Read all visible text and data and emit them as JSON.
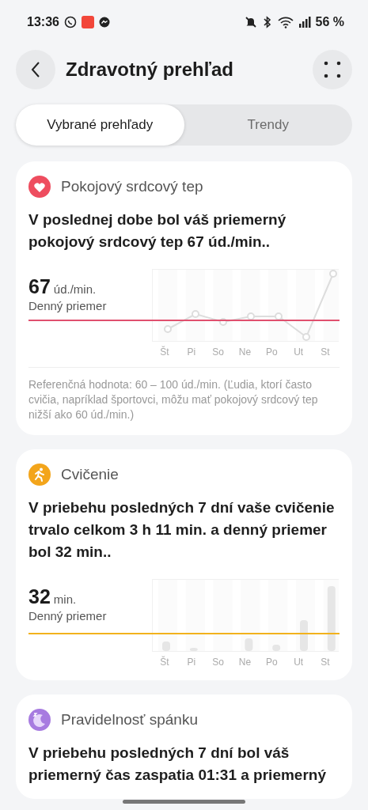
{
  "status_bar": {
    "time": "13:36",
    "battery": "56 %"
  },
  "header": {
    "title": "Zdravotný prehľad"
  },
  "tabs": [
    {
      "label": "Vybrané prehľady",
      "selected": true
    },
    {
      "label": "Trendy",
      "selected": false
    }
  ],
  "cards": [
    {
      "kind": "heart",
      "title": "Pokojový srdcový tep",
      "summary": "V poslednej dobe bol váš priemerný pokojový srdcový tep 67 úd./min..",
      "value": "67",
      "unit": "úd./min.",
      "caption": "Denný priemer",
      "color": "#e0506e",
      "days": [
        "Št",
        "Pi",
        "So",
        "Ne",
        "Po",
        "Ut",
        "St"
      ],
      "note": "Referenčná hodnota: 60 – 100 úd./min. (Ľudia, ktorí často cvičia, napríklad športovci, môžu mať pokojový srdcový tep nižší ako 60 úd./min.)"
    },
    {
      "kind": "exercise",
      "title": "Cvičenie",
      "summary": "V priebehu posledných 7 dní vaše cvičenie trvalo celkom 3 h 11 min. a denný priemer bol 32 min..",
      "value": "32",
      "unit": "min.",
      "caption": "Denný priemer",
      "color": "#f2b21c",
      "days": [
        "Št",
        "Pi",
        "So",
        "Ne",
        "Po",
        "Ut",
        "St"
      ]
    },
    {
      "kind": "sleep",
      "title": "Pravidelnosť spánku",
      "summary": "V priebehu posledných 7 dní bol váš priemerný čas zaspatia 01:31 a priemerný"
    }
  ]
}
